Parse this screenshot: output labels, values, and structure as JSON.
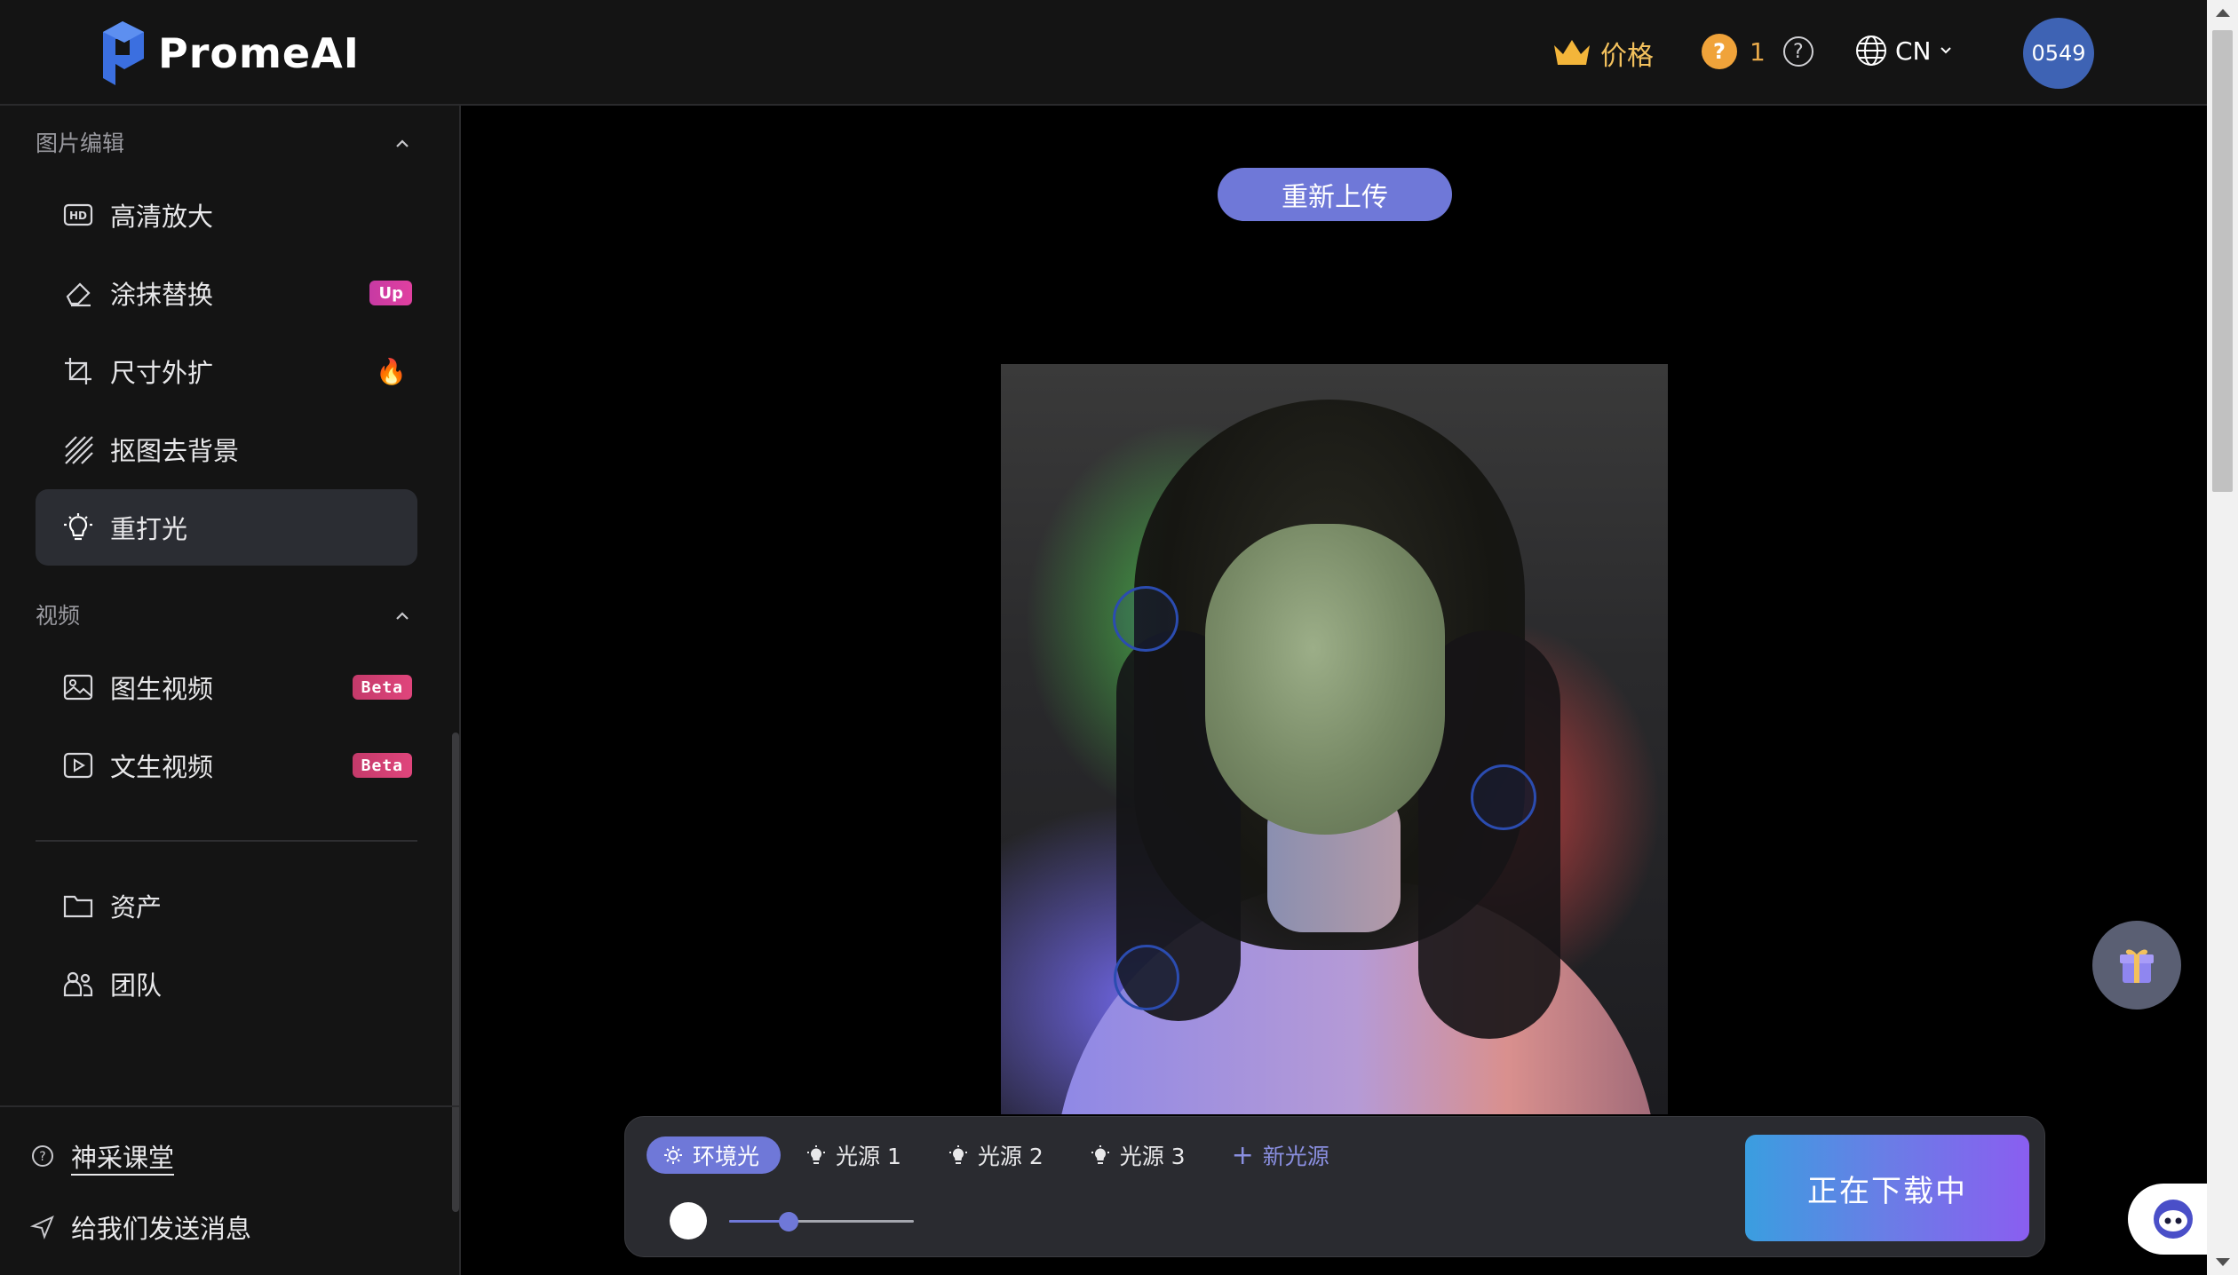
{
  "header": {
    "logo_text": "PromeAI",
    "price_label": "价格",
    "credits_count": "1",
    "coin_glyph": "?",
    "help_glyph": "?",
    "language": "CN",
    "avatar_text": "0549"
  },
  "sidebar": {
    "section_image": "图片编辑",
    "items_image": [
      {
        "label": "高清放大",
        "icon": "hd-icon"
      },
      {
        "label": "涂抹替换",
        "icon": "eraser-icon",
        "badge": "Up"
      },
      {
        "label": "尺寸外扩",
        "icon": "crop-icon",
        "badge": "🔥"
      },
      {
        "label": "抠图去背景",
        "icon": "stripes-icon"
      },
      {
        "label": "重打光",
        "icon": "lightbulb-icon",
        "active": true
      }
    ],
    "section_video": "视频",
    "items_video": [
      {
        "label": "图生视频",
        "icon": "image-video-icon",
        "badge": "Beta"
      },
      {
        "label": "文生视频",
        "icon": "play-icon",
        "badge": "Beta"
      }
    ],
    "items_misc": [
      {
        "label": "资产",
        "icon": "folder-icon"
      },
      {
        "label": "团队",
        "icon": "team-icon"
      }
    ],
    "footer": {
      "academy": "神采课堂",
      "feedback": "给我们发送消息"
    }
  },
  "main": {
    "reupload_label": "重新上传",
    "tabs": [
      {
        "label": "环境光",
        "active": true
      },
      {
        "label": "光源 1"
      },
      {
        "label": "光源 2"
      },
      {
        "label": "光源 3"
      }
    ],
    "add_light_label": "新光源",
    "add_light_glyph": "+",
    "intensity": 0.32,
    "download_label": "正在下载中"
  },
  "colors": {
    "accent": "#6f78d8",
    "badge_up": "#d93ea3",
    "badge_beta": "#e0457c",
    "price_gold": "#f3c15d"
  }
}
